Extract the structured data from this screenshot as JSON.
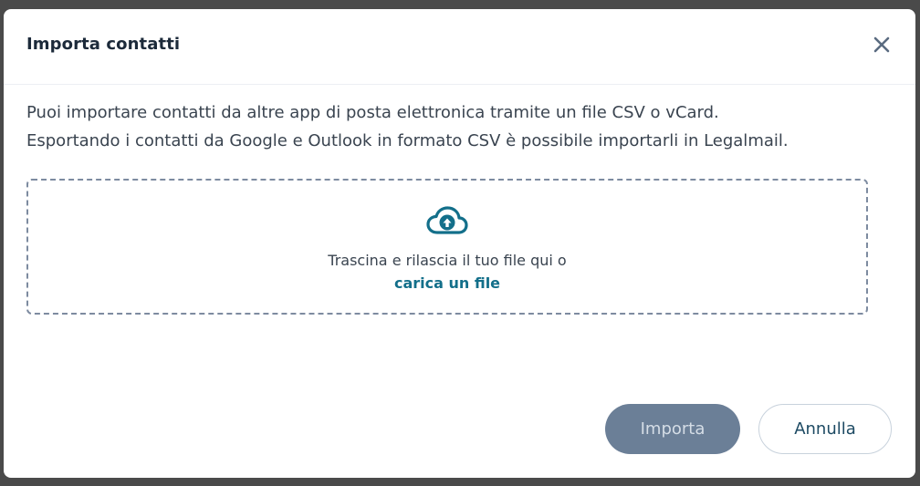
{
  "dialog": {
    "title": "Importa contatti",
    "close_icon": "close-icon"
  },
  "description": {
    "line1": "Puoi importare contatti da altre app di posta elettronica tramite un file CSV o vCard.",
    "line2": "Esportando i contatti da Google e Outlook in formato CSV è possibile importarli in Legalmail."
  },
  "dropzone": {
    "icon": "cloud-upload-icon",
    "text": "Trascina e rilascia il tuo file qui o",
    "link": "carica un file"
  },
  "footer": {
    "import_label": "Importa",
    "cancel_label": "Annulla"
  },
  "colors": {
    "accent": "#136f8a",
    "primary_button": "#6b7f97",
    "title": "#1c2a3a"
  }
}
